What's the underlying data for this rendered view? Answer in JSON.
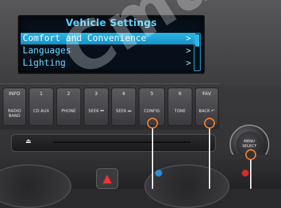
{
  "screen": {
    "title": "Vehicle Settings",
    "items": [
      {
        "label": "Comfort and Convenience",
        "selected": true
      },
      {
        "label": "Languages",
        "selected": false
      },
      {
        "label": "Lighting",
        "selected": false
      }
    ],
    "arrow_glyph": ">"
  },
  "buttons": [
    {
      "top": "INFO",
      "bottom": "RADIO BAND"
    },
    {
      "top": "1",
      "bottom": "CD AUX"
    },
    {
      "top": "2",
      "bottom": "PHONE"
    },
    {
      "top": "3",
      "bottom": "SEEK ⏮"
    },
    {
      "top": "4",
      "bottom": "SEEK ⏭"
    },
    {
      "top": "5",
      "bottom": "CONFIG"
    },
    {
      "top": "6",
      "bottom": "TONE"
    },
    {
      "top": "FAV",
      "bottom": "BACK ↶"
    }
  ],
  "knob": {
    "line1": "MENU",
    "line2": "SELECT"
  },
  "eject_glyph": "⏏",
  "hazard_glyph": "▲",
  "colors": {
    "accent": "#2ab7e6",
    "callout": "#f07a2a"
  }
}
